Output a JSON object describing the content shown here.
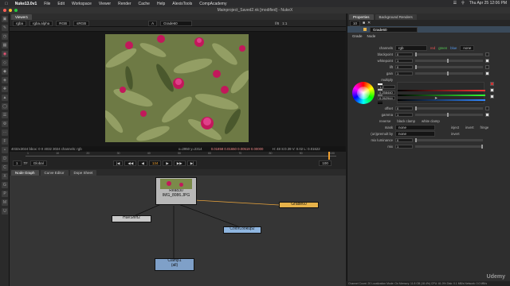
{
  "menubar": {
    "app": "Nuke13.0v1",
    "items": [
      "File",
      "Edit",
      "Workspace",
      "Viewer",
      "Render",
      "Cache",
      "Help",
      "AlexisTools",
      "CompAcademy"
    ],
    "clock": "Thu Apr 25  12:06 PM"
  },
  "window": {
    "title": "Mainproject_Saved2.nk [modified] - NukeX"
  },
  "viewer": {
    "tab": "Viewer1",
    "channels": "rgba",
    "alpha": "rgba.alpha",
    "colorspace": "RGB",
    "lut": "sRGB",
    "node_label": "Grade60",
    "zoom": "1:1",
    "fstop": "f/8",
    "caption_left": "4032x3024  bbox: 0 0 4032 3024 channels: rgb",
    "caption_coords": "x=2950 y=2314",
    "caption_values": "0.01858  0.01650  0.00519  0.00000",
    "caption_hsv": "H: 48 S:0.39 V: 0.02  L: 0.01622"
  },
  "timeline": {
    "frame": "1",
    "mode": "Global",
    "current": "134",
    "start": "1",
    "end": "100",
    "ticks": [
      "1",
      "10",
      "20",
      "30",
      "40",
      "50",
      "60",
      "70",
      "80",
      "90",
      "100"
    ]
  },
  "nodegraph": {
    "tabs": [
      "Node Graph",
      "Curve Editor",
      "Dope Sheet"
    ],
    "nodes": {
      "read": {
        "name": "Read30",
        "file": "IMG_8086.JPG"
      },
      "grade": {
        "name": "Grade60"
      },
      "hueshift": {
        "name": "HueShift2"
      },
      "colorlookup": {
        "name": "ColorLookup2"
      },
      "clamp": {
        "name": "Clamp1",
        "sub": "(all)"
      }
    }
  },
  "properties": {
    "tabs": [
      "Properties",
      "Background Renders"
    ],
    "node_name": "Grade60",
    "subtabs": [
      "Grade",
      "Node"
    ],
    "channels": "rgb",
    "channel_flags": [
      "red",
      "green",
      "blue",
      "none"
    ],
    "rows": [
      {
        "label": "blackpoint",
        "value": "0"
      },
      {
        "label": "whitepoint",
        "value": "1"
      },
      {
        "label": "lift",
        "value": "0"
      },
      {
        "label": "gain",
        "value": "1"
      },
      {
        "label": "multiply",
        "value": ""
      }
    ],
    "multiply_values": [
      "1.2",
      "0.258440",
      "0.262944"
    ],
    "offset": "0",
    "gamma": "1",
    "checks": [
      "reverse",
      "black clamp",
      "white clamp"
    ],
    "mask": "none",
    "mask_flags": [
      "inject",
      "invert",
      "fringe"
    ],
    "unpremult": "none",
    "invert_label": "invert",
    "mix_luminance": "0",
    "mix": "1",
    "labels": {
      "channels": "channels",
      "offset": "offset",
      "gamma": "gamma",
      "mask": "mask",
      "unpremult": "(un)premult by",
      "mixlum": "mix luminance",
      "mix": "mix"
    }
  },
  "status": "Channel Count: 20  Localization Mode: On  Memory: 11.8 GB (18.4%)  CPU: 61.0%  Disk: 0.1 MB/s  Network: 0.0 MB/s",
  "watermark": "Udemy"
}
